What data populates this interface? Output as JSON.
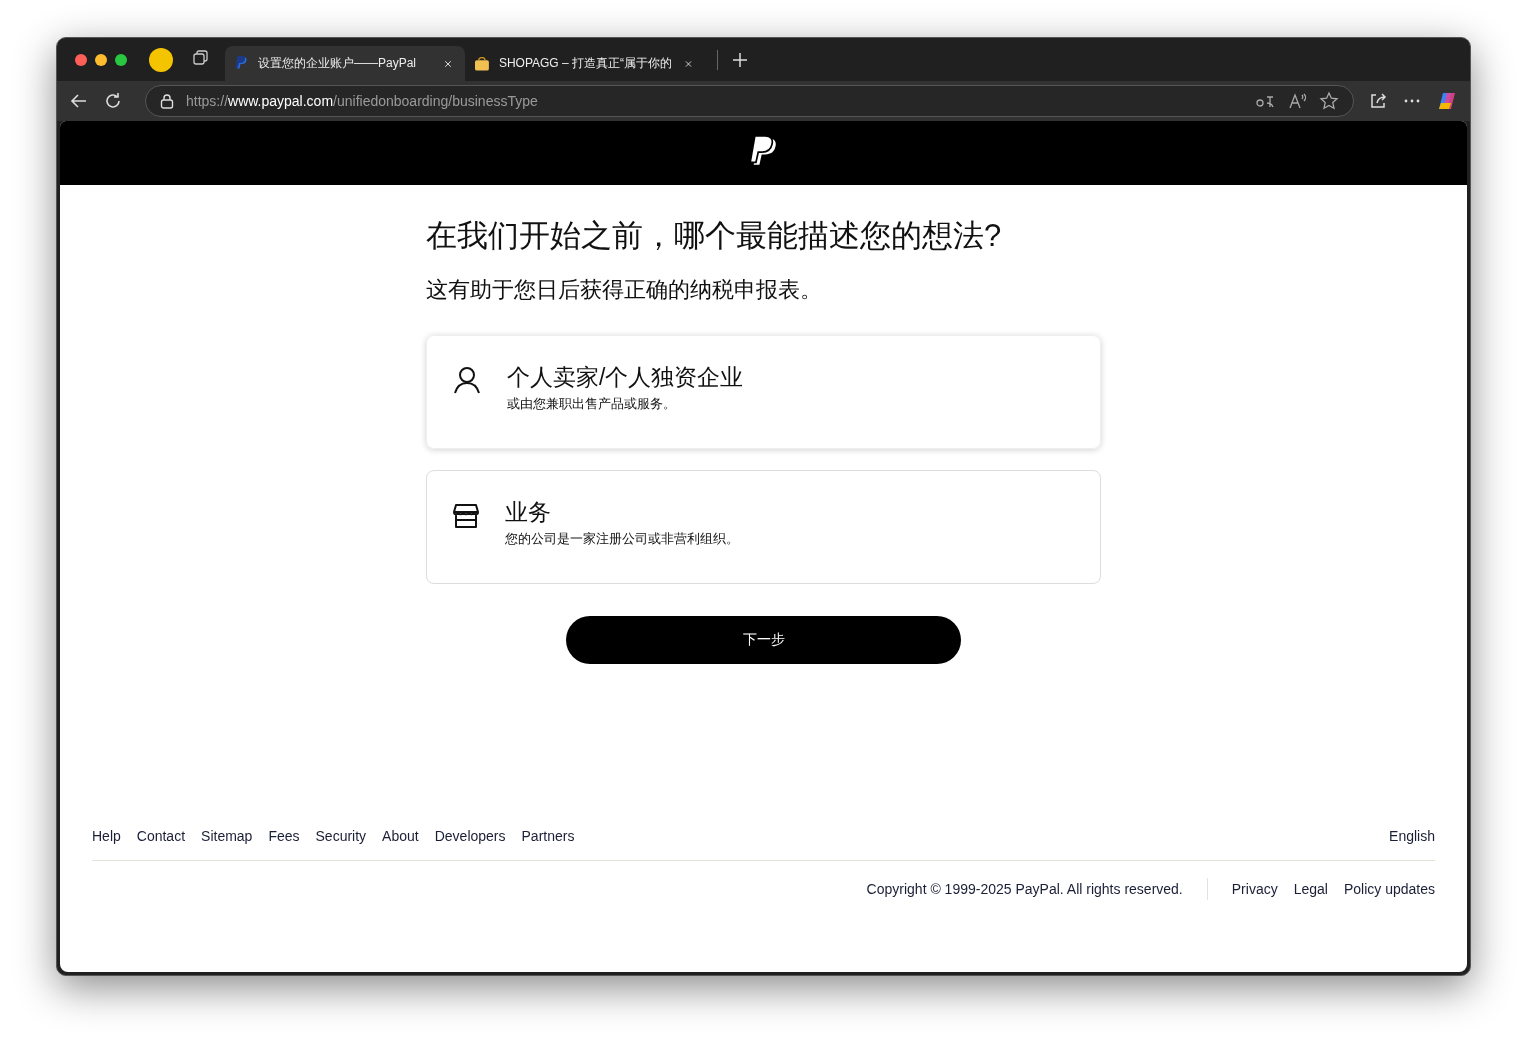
{
  "browser": {
    "tabs": [
      {
        "title": "设置您的企业账户——PayPal",
        "selected": true,
        "kind": "paypal"
      },
      {
        "title": "SHOPAGG – 打造真正“属于你的",
        "selected": false,
        "kind": "shop"
      }
    ],
    "address": "https://**www.paypal.com**/unifiedonboarding/businessType"
  },
  "page": {
    "title": "在我们开始之前，哪个最能描述您的想法?",
    "subtitle": "这有助于您日后获得正确的纳税申报表。",
    "options": [
      {
        "kind": "person",
        "title": "个人卖家/个人独资企业",
        "description": "或由您兼职出售产品或服务。",
        "selected": true
      },
      {
        "kind": "store",
        "title": "业务",
        "description": "您的公司是一家注册公司或非营利组织。",
        "selected": false
      }
    ],
    "next_button": "下一步"
  },
  "footer": {
    "links": [
      "Help",
      "Contact",
      "Sitemap",
      "Fees",
      "Security",
      "About",
      "Developers",
      "Partners"
    ],
    "language": "English",
    "copyright": "Copyright © 1999-2025 PayPal. All rights reserved.",
    "legal_links": [
      "Privacy",
      "Legal",
      "Policy updates"
    ]
  }
}
